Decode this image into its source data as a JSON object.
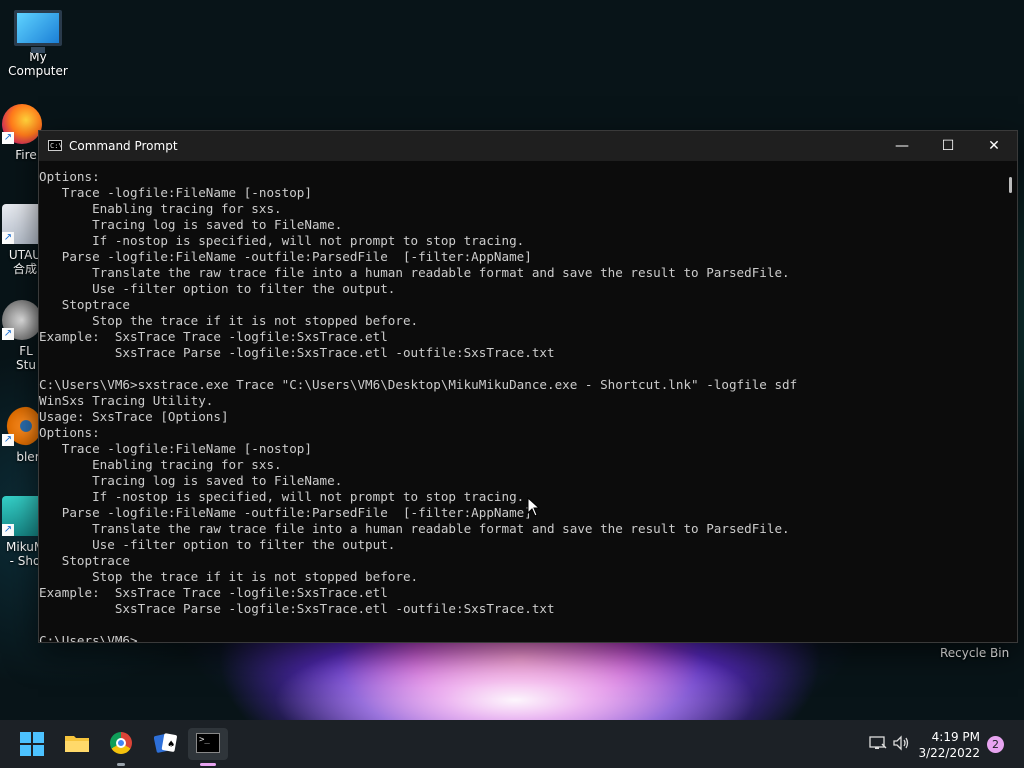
{
  "desktop": {
    "icons": [
      {
        "label": "My Computer"
      },
      {
        "label": "Fire"
      },
      {
        "label": "UTAU\n合成"
      },
      {
        "label": "FL Stu"
      },
      {
        "label": "bler"
      },
      {
        "label": "MikuM\n- Sho"
      }
    ],
    "recycle_bin": "Recycle Bin"
  },
  "window": {
    "title": "Command Prompt",
    "minimize_glyph": "—",
    "maximize_glyph": "☐",
    "close_glyph": "✕",
    "console_lines": [
      "Options:",
      "   Trace -logfile:FileName [-nostop]",
      "       Enabling tracing for sxs.",
      "       Tracing log is saved to FileName.",
      "       If -nostop is specified, will not prompt to stop tracing.",
      "   Parse -logfile:FileName -outfile:ParsedFile  [-filter:AppName]",
      "       Translate the raw trace file into a human readable format and save the result to ParsedFile.",
      "       Use -filter option to filter the output.",
      "   Stoptrace",
      "       Stop the trace if it is not stopped before.",
      "Example:  SxsTrace Trace -logfile:SxsTrace.etl",
      "          SxsTrace Parse -logfile:SxsTrace.etl -outfile:SxsTrace.txt",
      "",
      "C:\\Users\\VM6>sxstrace.exe Trace \"C:\\Users\\VM6\\Desktop\\MikuMikuDance.exe - Shortcut.lnk\" -logfile sdf",
      "WinSxs Tracing Utility.",
      "Usage: SxsTrace [Options]",
      "Options:",
      "   Trace -logfile:FileName [-nostop]",
      "       Enabling tracing for sxs.",
      "       Tracing log is saved to FileName.",
      "       If -nostop is specified, will not prompt to stop tracing.",
      "   Parse -logfile:FileName -outfile:ParsedFile  [-filter:AppName]",
      "       Translate the raw trace file into a human readable format and save the result to ParsedFile.",
      "       Use -filter option to filter the output.",
      "   Stoptrace",
      "       Stop the trace if it is not stopped before.",
      "Example:  SxsTrace Trace -logfile:SxsTrace.etl",
      "          SxsTrace Parse -logfile:SxsTrace.etl -outfile:SxsTrace.txt",
      "",
      "C:\\Users\\VM6>"
    ]
  },
  "taskbar": {
    "time": "4:19 PM",
    "date": "3/22/2022",
    "notification_count": "2",
    "apps": [
      "start-icon",
      "file-explorer-icon",
      "chrome-icon",
      "solitaire-icon",
      "command-prompt-icon"
    ],
    "accent": "#e7a4f0"
  }
}
